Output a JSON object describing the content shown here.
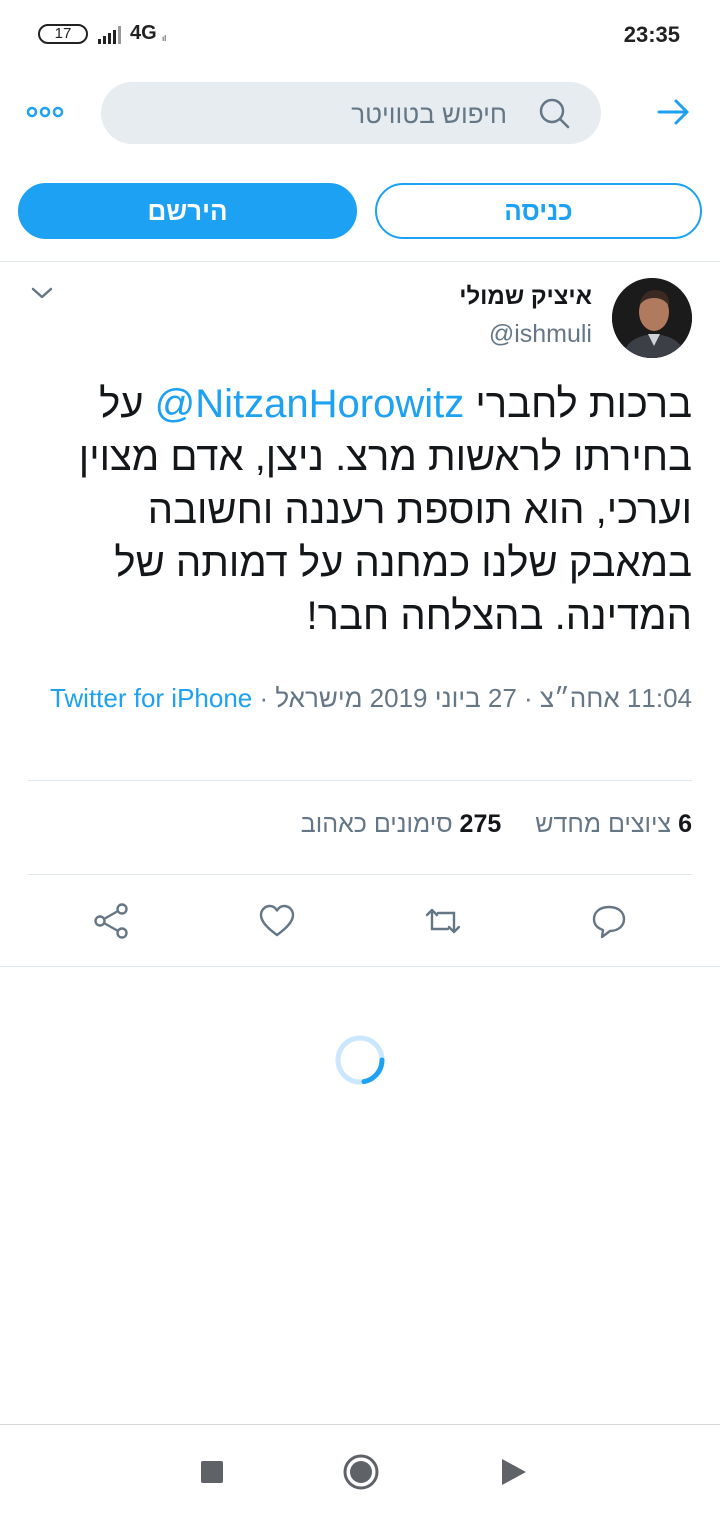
{
  "status_bar": {
    "battery": "17",
    "network": "4G",
    "network_sub": "ıl",
    "time": "23:35"
  },
  "search": {
    "placeholder": "חיפוש בטוויטר"
  },
  "auth": {
    "signup_label": "הירשם",
    "login_label": "כניסה"
  },
  "tweet": {
    "display_name": "איציק שמולי",
    "handle": "@ishmuli",
    "text_before": "ברכות לחברי ",
    "mention": "@NitzanHorowitz",
    "text_after": " על בחירתו לראשות מרצ. ניצן, אדם מצוין וערכי, הוא תוספת רעננה וחשובה במאבק שלנו כמחנה על דמותה של המדינה. בהצלחה חבר!",
    "meta_time": "11:04 אחה״צ · 27 ביוני 2019 מישראל · ",
    "meta_source": "Twitter for iPhone",
    "retweets_count": "6",
    "retweets_label": "ציוצים מחדש",
    "likes_count": "275",
    "likes_label": "סימונים כאהוב"
  },
  "colors": {
    "accent": "#1da1f2",
    "muted": "#657786",
    "text": "#14171a",
    "search_bg": "#e6ecf0"
  }
}
